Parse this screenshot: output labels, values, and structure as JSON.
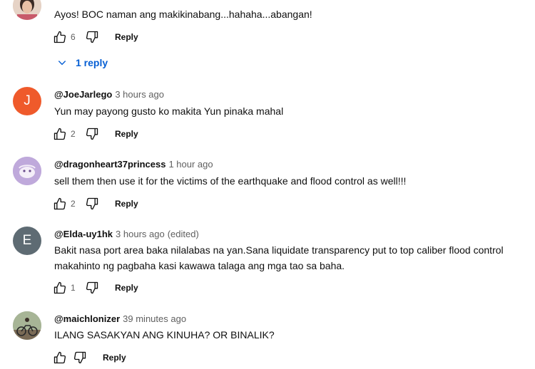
{
  "comments": [
    {
      "handle": "",
      "time": "",
      "edited": "",
      "avatar_letter": "",
      "avatar_color": "#d8b8a8",
      "text": "Ayos! BOC naman ang makikinabang...hahaha...abangan!",
      "likes": "6",
      "reply_label": "Reply"
    },
    {
      "handle": "@JoeJarlego",
      "time": "3 hours ago",
      "edited": "",
      "avatar_letter": "J",
      "avatar_color": "#ef5a2b",
      "text": "Yun may payong gusto ko makita Yun pinaka mahal",
      "likes": "2",
      "reply_label": "Reply"
    },
    {
      "handle": "@dragonheart37princess",
      "time": "1 hour ago",
      "edited": "",
      "avatar_letter": "",
      "avatar_color": "#a88cc8",
      "text": "sell them then use it for the victims of the earthquake and flood control as well!!!",
      "likes": "2",
      "reply_label": "Reply"
    },
    {
      "handle": "@Elda-uy1hk",
      "time": "3 hours ago",
      "edited": "(edited)",
      "avatar_letter": "E",
      "avatar_color": "#5e6b73",
      "text": "Bakit nasa port area baka nilalabas na yan.Sana liquidate transparency  put to top caliber flood control makahinto ng pagbaha kasi kawawa talaga ang mga tao sa baha.",
      "likes": "1",
      "reply_label": "Reply"
    },
    {
      "handle": "@maichlonizer",
      "time": "39 minutes ago",
      "edited": "",
      "avatar_letter": "",
      "avatar_color": "#8a9a7a",
      "text": "ILANG SASAKYAN ANG KINUHA? OR BINALIK?",
      "likes": "",
      "reply_label": "Reply"
    }
  ],
  "replies_toggle": {
    "label": "1 reply"
  },
  "icons": {
    "like": "thumbs-up-icon",
    "dislike": "thumbs-down-icon",
    "chevron": "chevron-down-icon"
  },
  "colors": {
    "link": "#065fd4",
    "secondary_text": "#606060"
  }
}
